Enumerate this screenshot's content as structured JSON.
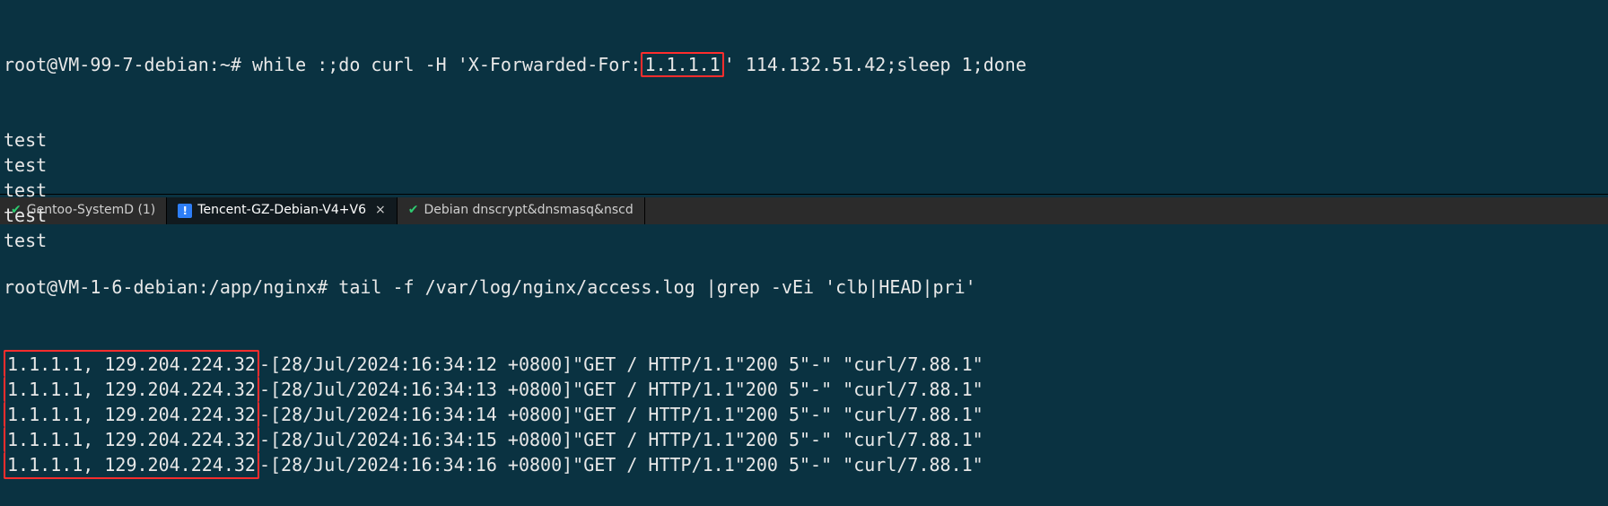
{
  "top": {
    "prompt": "root@VM-99-7-debian:~# ",
    "cmd_pre": "while :;do curl -H 'X-Forwarded-For:",
    "cmd_hl": "1.1.1.1",
    "cmd_post": "' 114.132.51.42;sleep 1;done",
    "outputs": [
      "test",
      "test",
      "test",
      "test",
      "test"
    ]
  },
  "tabs": [
    {
      "label": "Gentoo-SystemD (1)",
      "icon": "check",
      "active": false
    },
    {
      "label": "Tencent-GZ-Debian-V4+V6",
      "icon": "warn",
      "active": true
    },
    {
      "label": "Debian dnscrypt&dnsmasq&nscd",
      "icon": "check",
      "active": false
    }
  ],
  "bottom": {
    "prompt": "root@VM-1-6-debian:/app/nginx# ",
    "cmd": "tail -f /var/log/nginx/access.log |grep -vEi 'clb|HEAD|pri'",
    "log_lines": [
      {
        "ips": "1.1.1.1, 129.204.224.32",
        "sep": "-",
        "rest": "[28/Jul/2024:16:34:12 +0800]\"GET / HTTP/1.1\"200 5\"-\" \"curl/7.88.1\""
      },
      {
        "ips": "1.1.1.1, 129.204.224.32",
        "sep": "-",
        "rest": "[28/Jul/2024:16:34:13 +0800]\"GET / HTTP/1.1\"200 5\"-\" \"curl/7.88.1\""
      },
      {
        "ips": "1.1.1.1, 129.204.224.32",
        "sep": "-",
        "rest": "[28/Jul/2024:16:34:14 +0800]\"GET / HTTP/1.1\"200 5\"-\" \"curl/7.88.1\""
      },
      {
        "ips": "1.1.1.1, 129.204.224.32",
        "sep": "-",
        "rest": "[28/Jul/2024:16:34:15 +0800]\"GET / HTTP/1.1\"200 5\"-\" \"curl/7.88.1\""
      },
      {
        "ips": "1.1.1.1, 129.204.224.32",
        "sep": "-",
        "rest": "[28/Jul/2024:16:34:16 +0800]\"GET / HTTP/1.1\"200 5\"-\" \"curl/7.88.1\""
      }
    ]
  },
  "glyphs": {
    "check": "✔",
    "warn": "!",
    "close": "×"
  }
}
